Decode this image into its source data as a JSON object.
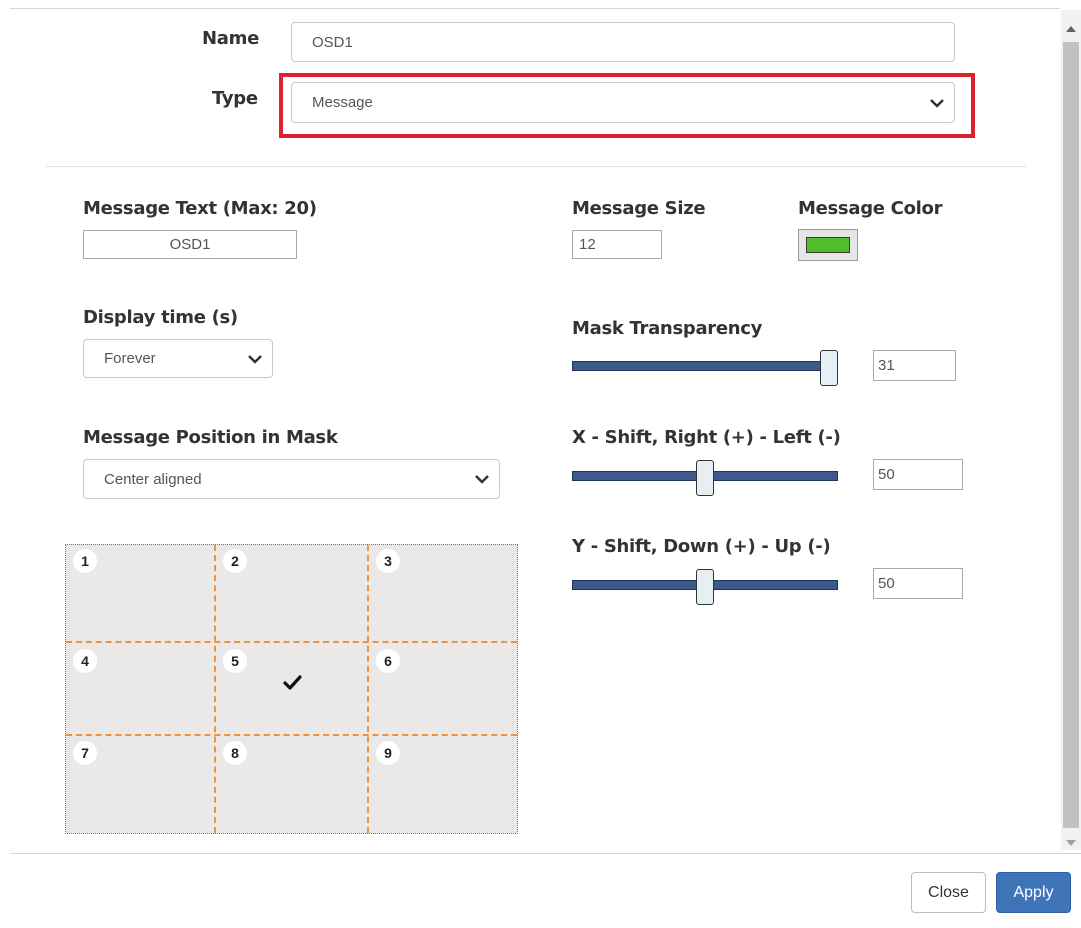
{
  "general": {
    "name_label": "Name",
    "name_value": "OSD1",
    "type_label": "Type",
    "type_value": "Message"
  },
  "message": {
    "text_label": "Message Text (Max: 20)",
    "text_value": "OSD1",
    "size_label": "Message Size",
    "size_value": "12",
    "color_label": "Message Color",
    "color_hex": "#4fbe2a"
  },
  "display_time": {
    "label": "Display time (s)",
    "value": "Forever"
  },
  "position": {
    "label": "Message Position in Mask",
    "value": "Center aligned",
    "cells": [
      "1",
      "2",
      "3",
      "4",
      "5",
      "6",
      "7",
      "8",
      "9"
    ],
    "selected_cell": "5"
  },
  "mask_transparency": {
    "label": "Mask Transparency",
    "value": "31",
    "min": 0,
    "max": 31
  },
  "x_shift": {
    "label": "X - Shift, Right (+) - Left (-)",
    "value": "50",
    "min": 0,
    "max": 100
  },
  "y_shift": {
    "label": "Y - Shift, Down (+) - Up (-)",
    "value": "50",
    "min": 0,
    "max": 100
  },
  "footer": {
    "close_label": "Close",
    "apply_label": "Apply"
  },
  "colors": {
    "highlight": "#d9232e",
    "apply_button": "#3e74b8",
    "grid_line": "#f0913c",
    "slider_track": "#3d5a8a"
  }
}
